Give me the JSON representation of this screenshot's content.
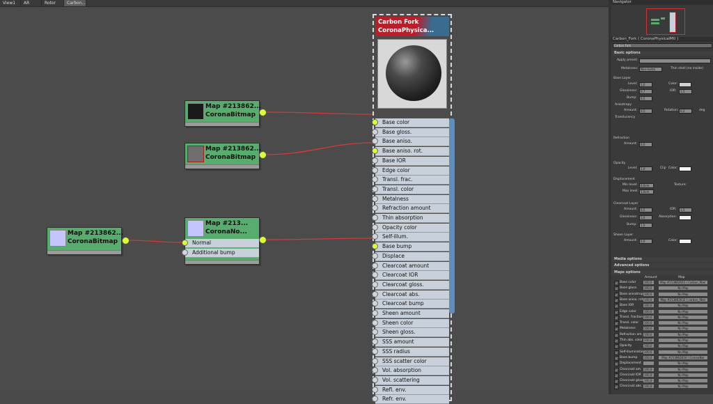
{
  "tabs": [
    "View1",
    "AR",
    "Rotor",
    "Carbon..."
  ],
  "nodes": [
    {
      "title": "Map #213862...",
      "subtitle": "CoronaBitmap",
      "thumb": "#1a1a1a"
    },
    {
      "title": "Map #213862...",
      "subtitle": "CoronaBitmap",
      "thumb": "#6e6e6e"
    },
    {
      "title": "Map #213862...",
      "subtitle": "CoronaBitmap",
      "thumb": "#c4c4ff"
    },
    {
      "title": "Map #213...",
      "subtitle": "CoronaNo...",
      "thumb": "#c4c4ff",
      "slots": [
        "Normal",
        "Additional bump"
      ]
    }
  ],
  "material": {
    "title": "Carbon Fork",
    "subtitle": "CoronaPhysica...",
    "slots": [
      "Base color",
      "Base gloss.",
      "Base aniso.",
      "Base aniso. rot.",
      "Base IOR",
      "Edge color",
      "Transl. frac.",
      "Transl. color",
      "Metalness",
      "Refraction amount",
      "Thin absorption",
      "Opacity color",
      "Self-illum.",
      "Base bump",
      "Displace",
      "Clearcoat amount",
      "Clearcoat IOR",
      "Clearcoat gloss.",
      "Clearcoat abs.",
      "Clearcoat bump",
      "Sheen amount",
      "Sheen color",
      "Sheen gloss.",
      "SSS amount",
      "SSS radius",
      "SSS scatter color",
      "Vol. absorption",
      "Vol. scattering",
      "Refl. env.",
      "Refr. env."
    ],
    "connected": [
      0,
      3,
      13
    ]
  },
  "right": {
    "navigator": "Navigator",
    "mat_header": "Carbon_Fork  ( CoronaPhysicalMtl )",
    "name_field": "Carbon Fork",
    "basic": "Basic options",
    "apply_preset": "Apply preset:",
    "metalness_lbl": "Metalness:",
    "metalness_val": "Non-metal",
    "thin_shell": "Thin shell (no inside)",
    "base_layer": "Base Layer",
    "level": "Level:",
    "level_v": "1,0",
    "color": "Color:",
    "glossiness": "Glossiness:",
    "gloss_v": "0,7",
    "ior": "IOR:",
    "ior_v": "1,5",
    "bump": "Bump:",
    "bump_v": "0,5",
    "anisotropy": "Anisotropy",
    "amount": "Amount:",
    "aniso_v": "0,5",
    "rotation": "Rotation:",
    "rot_v": "0,2",
    "deg": "deg",
    "translucency": "Translucency",
    "refraction": "Refraction",
    "refr_amount_v": "0,0",
    "opacity": "Opacity",
    "op_level_v": "1,0",
    "clip": "Clip",
    "displacement": "Displacement",
    "min_level": "Min level:",
    "min_v": "0,0cm",
    "max_level": "Max level:",
    "max_v": "1,0cm",
    "texture": "Texture:",
    "clearcoat": "Clearcoat Layer",
    "cc_amount_v": "0,5",
    "cc_ior_v": "1,5",
    "cc_gloss_v": "1,0",
    "cc_bump_v": "1,0",
    "absorption": "Absorption:",
    "sheen": "Sheen Layer",
    "sh_amount_v": "0,0",
    "media": "Media options",
    "advanced": "Advanced options",
    "maps": "Maps options",
    "col_amount": "Amount",
    "col_map": "Map",
    "map_rows": [
      {
        "n": "Base color",
        "a": "100,0",
        "m": "Map #213862631 ( Carbon_fiber"
      },
      {
        "n": "Base gloss.",
        "a": "100,0",
        "m": "No Map"
      },
      {
        "n": "Base anisotropy",
        "a": "100,0",
        "m": "No Map"
      },
      {
        "n": "Base aniso. rot.",
        "a": "100,0",
        "m": "Map #213862632 ( carbon_fiber"
      },
      {
        "n": "Base IOR",
        "a": "100,0",
        "m": "No Map"
      },
      {
        "n": "Edge color",
        "a": "100,0",
        "m": "No Map"
      },
      {
        "n": "Transl. fraction",
        "a": "100,0",
        "m": "No Map"
      },
      {
        "n": "Transl. color",
        "a": "100,0",
        "m": "No Map"
      },
      {
        "n": "Metalness",
        "a": "100,0",
        "m": "No Map"
      },
      {
        "n": "Refraction am.",
        "a": "100,0",
        "m": "No Map"
      },
      {
        "n": "Thin abs. color",
        "a": "100,0",
        "m": "No Map"
      },
      {
        "n": "Opacity",
        "a": "100,0",
        "m": "No Map"
      },
      {
        "n": "Self-illumination",
        "a": "100,0",
        "m": "No Map"
      },
      {
        "n": "Base bump",
        "a": "100,0",
        "m": "Map #213862634 ( CoronaNor"
      },
      {
        "n": "Displacement",
        "a": "",
        "m": "No Map"
      },
      {
        "n": "Clearcoat am.",
        "a": "100,0",
        "m": "No Map"
      },
      {
        "n": "Clearcoat IOR",
        "a": "100,0",
        "m": "No Map"
      },
      {
        "n": "Clearcoat gloss.",
        "a": "100,0",
        "m": "No Map"
      },
      {
        "n": "Clearcoat abs.",
        "a": "100,0",
        "m": "No Map"
      }
    ]
  }
}
